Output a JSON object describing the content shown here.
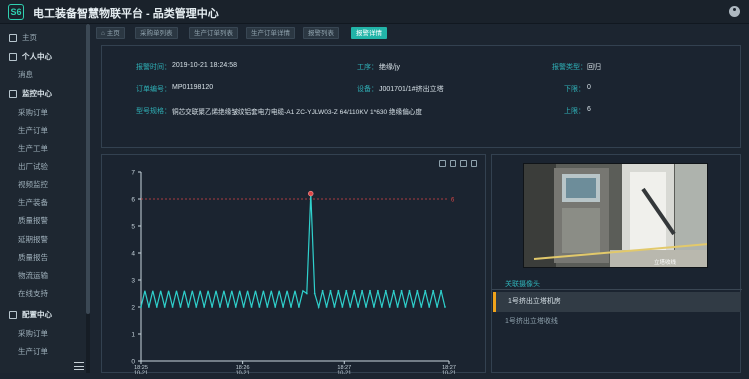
{
  "app": {
    "title": "电工装备智慧物联平台 - 品类管理中心",
    "logo": "S6"
  },
  "sidebar": {
    "home": "主页",
    "personal_center": "个人中心",
    "messages": "消息",
    "monitor_center": "监控中心",
    "monitor_items": [
      "采购订单",
      "生产订单",
      "生产工单",
      "出厂试验",
      "视频监控",
      "生产装备",
      "质量报警",
      "延期报警",
      "质量报告",
      "物流运输",
      "在线支持"
    ],
    "config_center": "配置中心",
    "config_items": [
      "采购订单",
      "生产订单"
    ]
  },
  "breadcrumbs": [
    "主页",
    "采购单列表",
    "生产订单列表",
    "生产订单详情",
    "报警列表",
    "报警详情"
  ],
  "alarm_info": {
    "alarm_time_label": "报警时间：",
    "alarm_time": "2019-10-21 18:24:58",
    "process_label": "工序：",
    "process": "绝缘/jy",
    "alarm_type_label": "报警类型：",
    "alarm_type": "回归",
    "order_no_label": "订单编号：",
    "order_no": "MP01198120",
    "device_label": "设备：",
    "device": "J001701/1#挤出立塔",
    "lower_limit_label": "下限：",
    "lower_limit": "0",
    "spec_label": "型号规格：",
    "spec": "铜芯交联聚乙烯绝缘皱纹铝套电力电缆-A1 ZC-YJLW03-Z 64/110KV 1*630 绝缘偏心度",
    "upper_limit_label": "上限：",
    "upper_limit": "6"
  },
  "camera": {
    "title": "关联摄像头",
    "items": [
      "1号挤出立塔机房",
      "1号挤出立塔收线"
    ],
    "image_caption": "立塔收线"
  },
  "icons": {
    "home": "home-icon",
    "user": "user-icon",
    "monitor": "monitor-icon",
    "config": "config-icon",
    "menu": "hamburger-icon",
    "chart_tools": [
      "fullscreen-icon",
      "bar-icon",
      "refresh-icon",
      "download-icon"
    ]
  },
  "colors": {
    "accent": "#22b4a8",
    "series": "#2fd0cc",
    "upper_limit_line": "#d84646",
    "active_marker": "#f0a31b"
  },
  "chart_data": {
    "type": "line",
    "title": "",
    "xlabel": "",
    "ylabel": "",
    "ylim": [
      0,
      7
    ],
    "yticks": [
      0,
      1,
      2,
      3,
      4,
      5,
      6,
      7
    ],
    "x_tick_labels": [
      "18:25\n10-21",
      "18:26\n10-21",
      "18:27\n10-21",
      "18:27\n10-21"
    ],
    "limit_line": {
      "value": 6,
      "label": "6"
    },
    "series": [
      {
        "values": [
          2,
          2.6,
          2,
          2.6,
          2,
          2.6,
          2,
          2.6,
          2,
          2.6,
          2,
          2.6,
          2,
          2.6,
          2,
          2.6,
          2,
          2.6,
          2,
          2.6,
          2,
          2.6,
          2,
          2.6,
          2,
          2.6,
          2,
          2.6,
          2,
          2.6,
          2,
          2.6,
          2,
          2.6,
          2,
          2.6,
          2,
          2.6,
          2,
          2.6,
          2,
          2.6,
          2.5,
          6.2,
          2.5,
          2,
          2.6,
          2,
          2.6,
          2,
          2.6,
          2,
          2.6,
          2,
          2.6,
          2,
          2.6,
          2,
          2.6,
          2,
          2.6,
          2,
          2.6,
          2,
          2.6,
          2,
          2.6,
          2,
          2.6,
          2,
          2.6,
          2,
          2.6,
          2,
          2.6,
          2,
          2.6,
          2
        ]
      }
    ],
    "highlight_point": {
      "index": 43,
      "value": 6.2
    }
  }
}
